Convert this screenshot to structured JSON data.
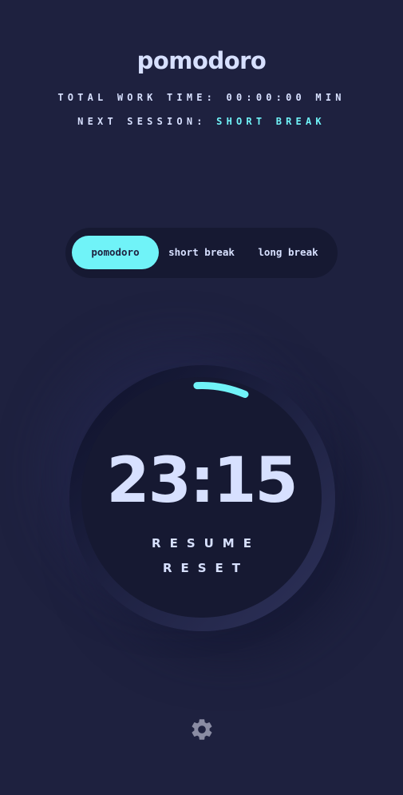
{
  "app": {
    "title": "pomodoro"
  },
  "info": {
    "total_work_label": "TOTAL WORK TIME:",
    "total_work_value": "00:00:00",
    "total_work_unit": "MIN",
    "next_session_label": "NEXT SESSION:",
    "next_session_value": "SHORT BREAK"
  },
  "modes": [
    {
      "label": "pomodoro",
      "active": true
    },
    {
      "label": "short break",
      "active": false
    },
    {
      "label": "long break",
      "active": false
    }
  ],
  "timer": {
    "time": "23:15",
    "progress_fraction": 0.07,
    "resume_label": "RESUME",
    "reset_label": "RESET"
  },
  "settings": {
    "icon": "gear-icon"
  },
  "colors": {
    "background": "#1e213f",
    "panel": "#161932",
    "accent": "#70f3f8",
    "text": "#d7e0ff"
  }
}
